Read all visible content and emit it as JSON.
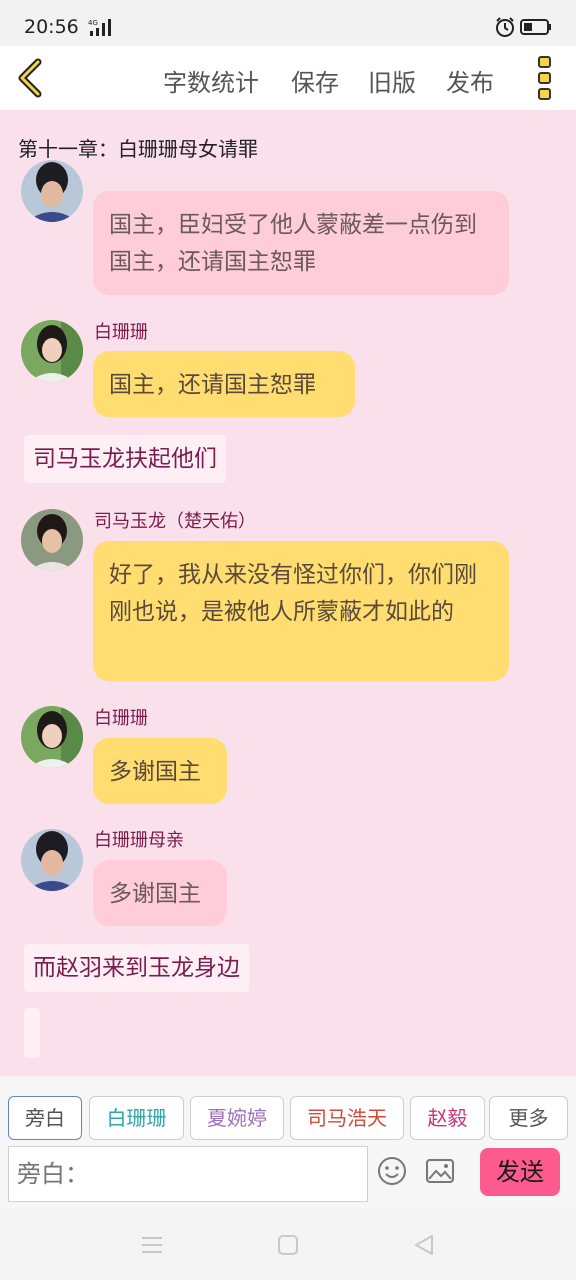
{
  "status_bar": {
    "time": "20:56",
    "network": "4G"
  },
  "toolbar": {
    "word_count": "字数统计",
    "save": "保存",
    "old_version": "旧版",
    "publish": "发布"
  },
  "chapter_title": "第十一章：白珊珊母女请罪",
  "colors": {
    "pink_bubble": "#ffcdda",
    "yellow_bubble": "#ffdd71",
    "send": "#fd5b8e"
  },
  "messages": [
    {
      "type": "dialog",
      "speaker": "",
      "text": "国主，臣妇受了他人蒙蔽差一点伤到国主，还请国主恕罪",
      "color": "pink"
    },
    {
      "type": "dialog",
      "speaker": "白珊珊",
      "text": "国主，还请国主恕罪",
      "color": "yellow"
    },
    {
      "type": "narration",
      "text": "司马玉龙扶起他们"
    },
    {
      "type": "dialog",
      "speaker": "司马玉龙（楚天佑）",
      "text": "好了，我从来没有怪过你们，你们刚刚也说，是被他人所蒙蔽才如此的",
      "color": "yellow"
    },
    {
      "type": "dialog",
      "speaker": "白珊珊",
      "text": "多谢国主",
      "color": "yellow"
    },
    {
      "type": "dialog",
      "speaker": "白珊珊母亲",
      "text": "多谢国主",
      "color": "pink"
    },
    {
      "type": "narration",
      "text": "而赵羽来到玉龙身边"
    }
  ],
  "roles": [
    {
      "label": "旁白",
      "color": "#555555",
      "active": true
    },
    {
      "label": "白珊珊",
      "color": "#2aa8a8"
    },
    {
      "label": "夏婉婷",
      "color": "#a070c0"
    },
    {
      "label": "司马浩天",
      "color": "#d04a3a"
    },
    {
      "label": "赵毅",
      "color": "#d0307a"
    },
    {
      "label": "更多",
      "color": "#555555"
    }
  ],
  "input": {
    "placeholder": "旁白："
  },
  "send_label": "发送"
}
